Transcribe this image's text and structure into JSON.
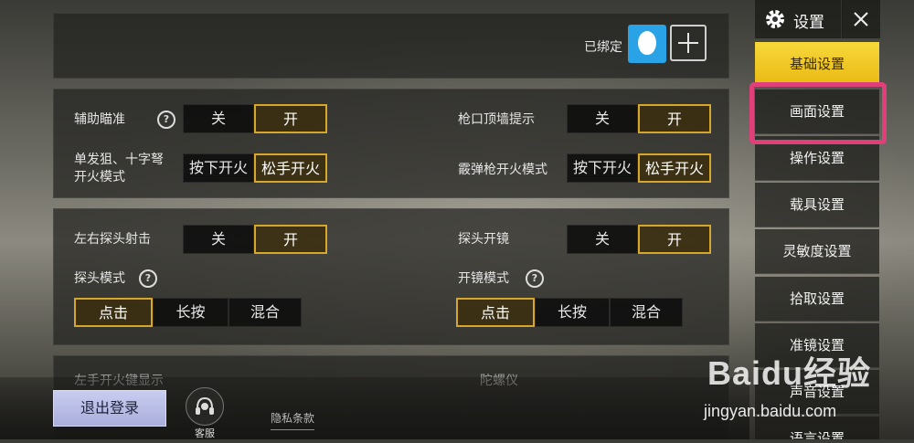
{
  "header": {
    "title": "设置"
  },
  "account": {
    "bound_label": "已绑定"
  },
  "section1": {
    "assist_aim": {
      "label": "辅助瞄准",
      "options": [
        "关",
        "开"
      ],
      "selected": "开"
    },
    "wall_hint": {
      "label": "枪口顶墙提示",
      "options": [
        "关",
        "开"
      ],
      "selected": "开"
    },
    "sniper_fire": {
      "label_line1": "单发狙、十字弩",
      "label_line2": "开火模式",
      "options": [
        "按下开火",
        "松手开火"
      ],
      "selected": "松手开火"
    },
    "shotgun_fire": {
      "label": "霰弹枪开火模式",
      "options": [
        "按下开火",
        "松手开火"
      ],
      "selected": "松手开火"
    }
  },
  "section2": {
    "peek_shoot": {
      "label": "左右探头射击",
      "options": [
        "关",
        "开"
      ],
      "selected": "开"
    },
    "peek_scope": {
      "label": "探头开镜",
      "options": [
        "关",
        "开"
      ],
      "selected": "开"
    },
    "peek_mode": {
      "label": "探头模式",
      "options": [
        "点击",
        "长按",
        "混合"
      ],
      "selected": "点击"
    },
    "scope_mode": {
      "label": "开镜模式",
      "options": [
        "点击",
        "长按",
        "混合"
      ],
      "selected": "点击"
    }
  },
  "section3": {
    "left_label": "左手开火键显示",
    "right_label": "陀螺仪"
  },
  "sidebar": {
    "items": [
      {
        "label": "基础设置"
      },
      {
        "label": "画面设置"
      },
      {
        "label": "操作设置"
      },
      {
        "label": "载具设置"
      },
      {
        "label": "灵敏度设置"
      },
      {
        "label": "拾取设置"
      },
      {
        "label": "准镜设置"
      },
      {
        "label": "声音设置"
      },
      {
        "label": "语言设置"
      }
    ],
    "active_index": 0,
    "highlighted_index": 1
  },
  "footer": {
    "logout": "退出登录",
    "service": "客服",
    "privacy": "隐私条款"
  },
  "watermark": {
    "brand": "Baidu经验",
    "url": "jingyan.baidu.com"
  },
  "colors": {
    "accent": "#d6a72a",
    "active_tab": "#f2cc2a",
    "highlight": "#e0407a",
    "qq_blue": "#2aa3e6"
  }
}
